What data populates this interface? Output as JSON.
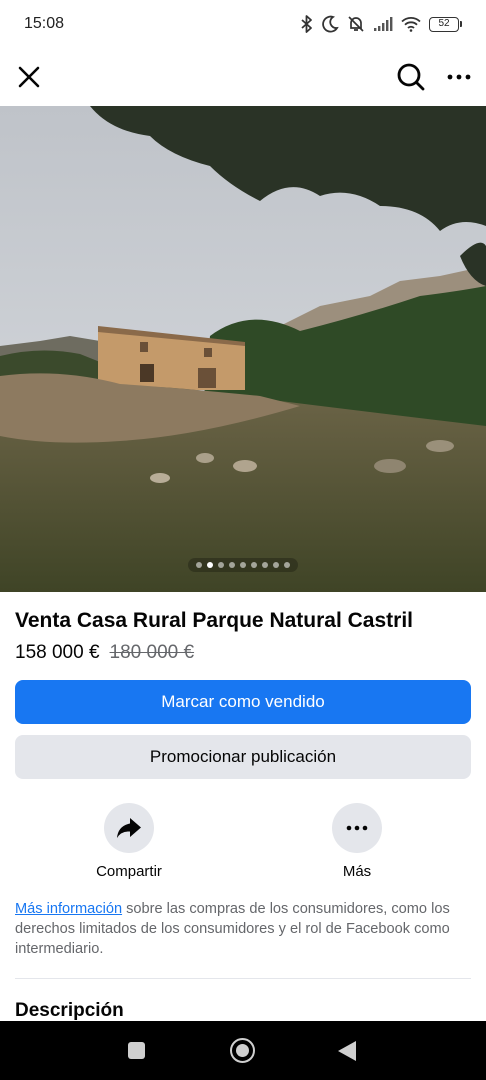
{
  "status_bar": {
    "time": "15:08",
    "battery": "52",
    "icons": [
      "bluetooth-icon",
      "moon-icon",
      "bell-off-icon",
      "signal-icon",
      "wifi-icon",
      "battery-icon"
    ]
  },
  "top_bar": {
    "icons": [
      "close-icon",
      "search-icon",
      "more-icon"
    ]
  },
  "photo": {
    "dot_count": 9,
    "active_index": 1
  },
  "listing": {
    "title": "Venta Casa Rural Parque Natural Castril",
    "price": "158 000 €",
    "old_price": "180 000 €"
  },
  "buttons": {
    "mark_sold": "Marcar como vendido",
    "promote": "Promocionar publicación"
  },
  "actions": {
    "share_label": "Compartir",
    "more_label": "Más"
  },
  "info": {
    "link_text": "Más información",
    "text": " sobre las compras de los consumidores, como los derechos limitados de los consumidores y el rol de Facebook como intermediario."
  },
  "description": {
    "heading": "Descripción"
  },
  "colors": {
    "accent": "#1877f2",
    "secondary_button": "#e4e6eb",
    "muted_text": "#65676b"
  }
}
